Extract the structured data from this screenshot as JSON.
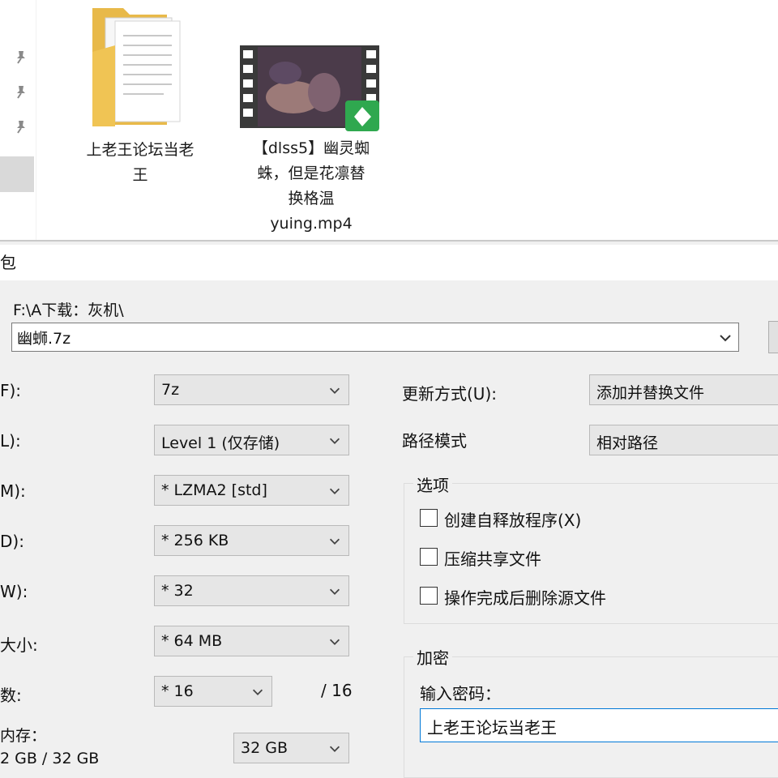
{
  "explorer": {
    "files": [
      {
        "name": "上老王论坛当老\n王",
        "type": "folder",
        "icon": "folder-icon"
      },
      {
        "name": "【dlss5】幽灵蜘\n蛛，但是花凛替\n换格温\nyuing.mp4",
        "type": "video",
        "icon": "video-thumbnail",
        "badge_icon": "player-app-badge-icon"
      }
    ]
  },
  "dialog": {
    "title": "包",
    "path": "F:\\A下载：灰机\\",
    "archive_name": "幽蛳.7z",
    "left_rows": [
      {
        "label": "F):",
        "value": "7z"
      },
      {
        "label": "L):",
        "value": "Level 1 (仅存储)"
      },
      {
        "label": "M):",
        "value": "*  LZMA2 [std]"
      },
      {
        "label": "D):",
        "value": "*  256 KB"
      },
      {
        "label": "W):",
        "value": "*  32"
      },
      {
        "label": "大小:",
        "value": "*  64 MB"
      },
      {
        "label": "数:",
        "value": "*  16"
      }
    ],
    "threads_max": "/ 16",
    "memory": {
      "label": "内存：",
      "usage": "2 GB / 32 GB",
      "value": "32 GB"
    },
    "update_mode": {
      "label": "更新方式(U):",
      "value": "添加并替换文件"
    },
    "path_mode": {
      "label": "路径模式",
      "value": "相对路径"
    },
    "options": {
      "title": "选项",
      "items": [
        {
          "label": "创建自释放程序(X)",
          "checked": false
        },
        {
          "label": "压缩共享文件",
          "checked": false
        },
        {
          "label": "操作完成后删除源文件",
          "checked": false
        }
      ]
    },
    "encryption": {
      "title": "加密",
      "password_label": "输入密码：",
      "password_value": "上老王论坛当老王"
    }
  }
}
